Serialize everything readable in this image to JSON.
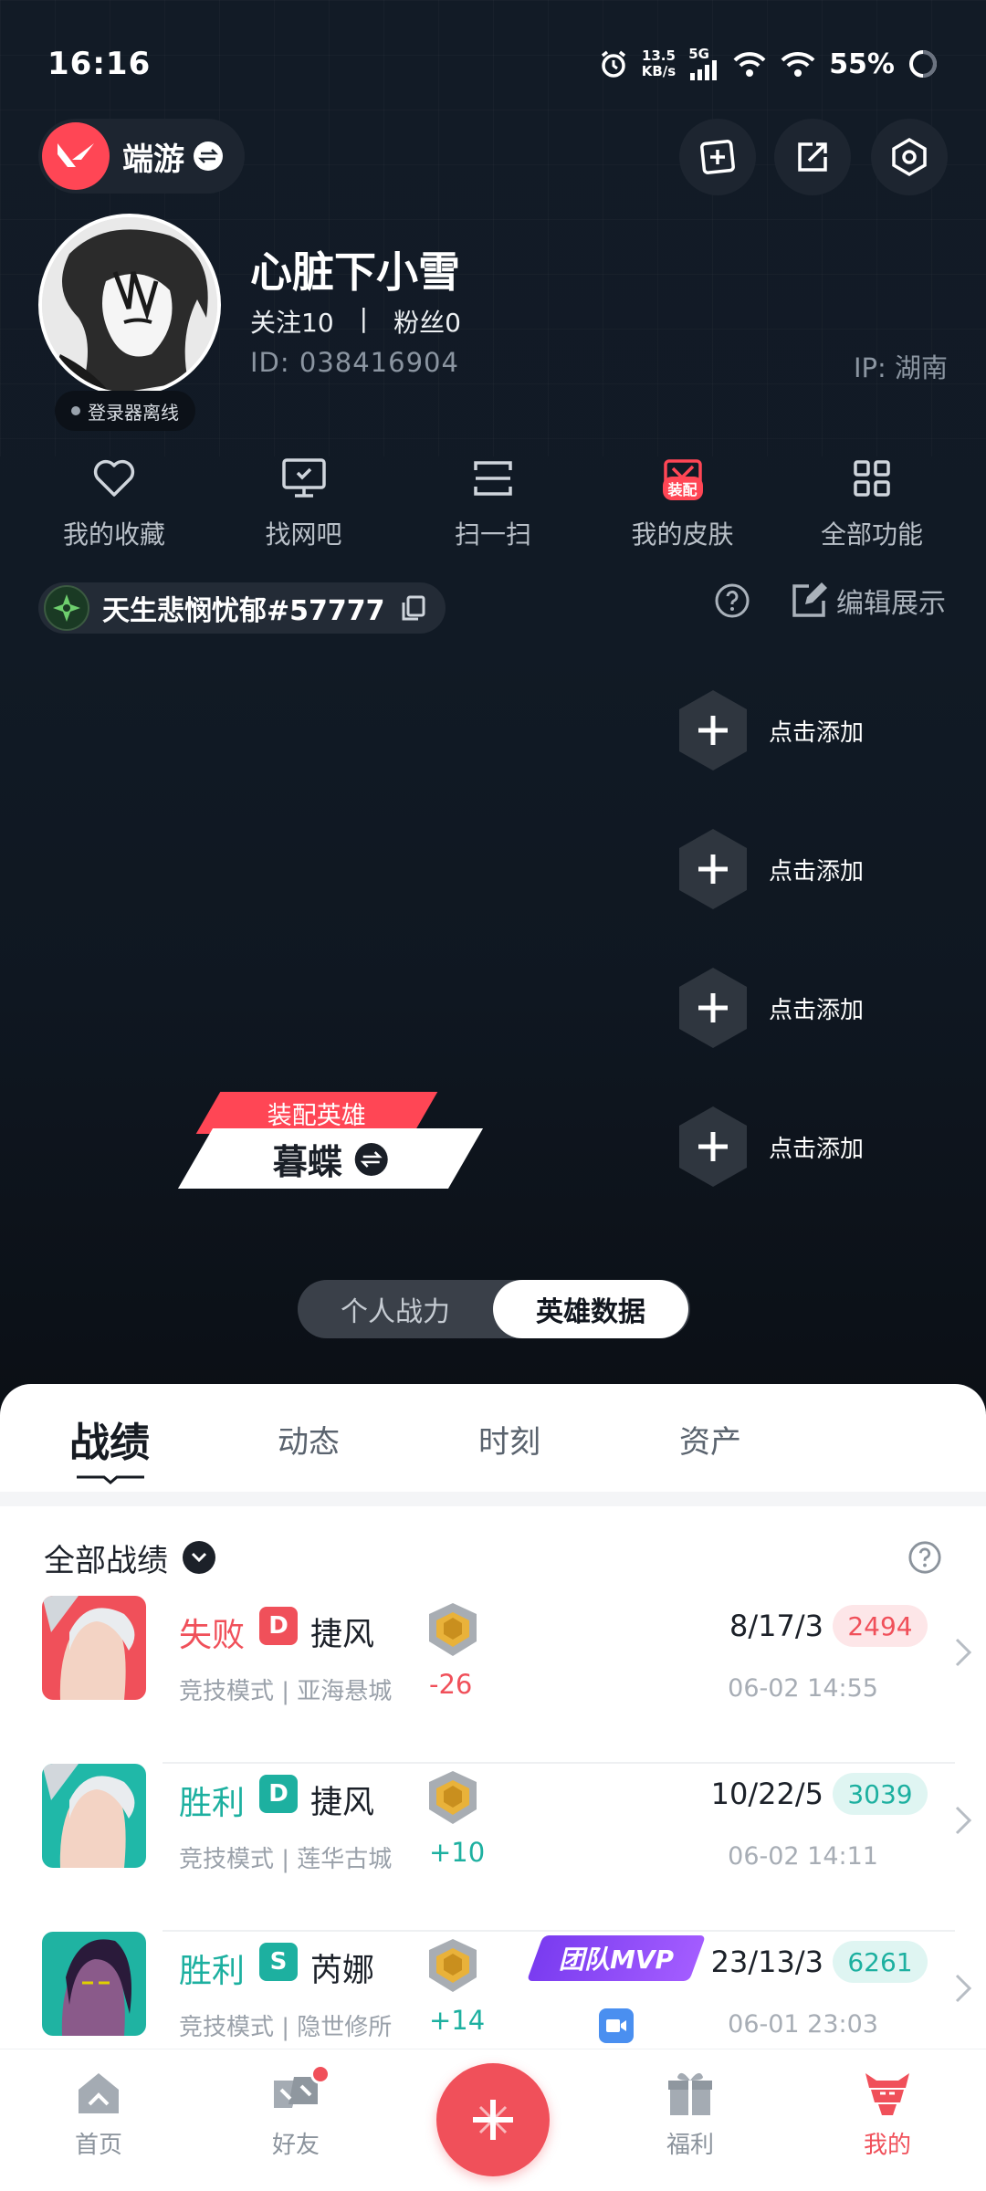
{
  "status": {
    "time": "16:16",
    "net_speed_value": "13.5",
    "net_speed_unit": "KB/s",
    "network": "5G",
    "battery": "55%"
  },
  "header": {
    "game_name": "端游"
  },
  "profile": {
    "name": "心脏下小雪",
    "following_label": "关注",
    "following_count": "10",
    "fans_label": "粉丝",
    "fans_count": "0",
    "separator": "|",
    "id_text": "ID:  038416904",
    "ip_text": "IP:  湖南",
    "login_status": "登录器离线"
  },
  "quick_functions": [
    {
      "label": "我的收藏",
      "icon": "heart-icon"
    },
    {
      "label": "找网吧",
      "icon": "monitor-icon"
    },
    {
      "label": "扫一扫",
      "icon": "scan-icon"
    },
    {
      "label": "我的皮肤",
      "icon": "skin-icon",
      "tag": "装配"
    },
    {
      "label": "全部功能",
      "icon": "grid-icon"
    }
  ],
  "riot_id": "天生悲悯忧郁#57777",
  "edit_show_label": "编辑展示",
  "add_slots": [
    {
      "label": "点击添加"
    },
    {
      "label": "点击添加"
    },
    {
      "label": "点击添加"
    },
    {
      "label": "点击添加"
    }
  ],
  "equipped_hero": {
    "tag": "装配英雄",
    "name": "暮蝶"
  },
  "segment": {
    "left": "个人战力",
    "right": "英雄数据",
    "active": "right"
  },
  "tabs": [
    "战绩",
    "动态",
    "时刻",
    "资产"
  ],
  "filter_label": "全部战绩",
  "matches": [
    {
      "result": "失败",
      "result_type": "lose",
      "mode_letter": "D",
      "agent": "捷风",
      "sub": "竞技模式 | 亚海悬城",
      "rr": "-26",
      "kda": "8/17/3",
      "score": "2494",
      "time": "06-02 14:55"
    },
    {
      "result": "胜利",
      "result_type": "win",
      "mode_letter": "D",
      "agent": "捷风",
      "sub": "竞技模式 | 莲华古城",
      "rr": "+10",
      "kda": "10/22/5",
      "score": "3039",
      "time": "06-02 14:11"
    },
    {
      "result": "胜利",
      "result_type": "win",
      "mode_letter": "S",
      "agent": "芮娜",
      "sub": "竞技模式 | 隐世修所",
      "rr": "+14",
      "kda": "23/13/3",
      "score": "6261",
      "time": "06-01 23:03",
      "badge": "团队MVP"
    }
  ],
  "nav": [
    {
      "label": "首页",
      "icon": "home-icon"
    },
    {
      "label": "好友",
      "icon": "friends-icon"
    },
    {
      "label": "福利",
      "icon": "gift-icon"
    },
    {
      "label": "我的",
      "icon": "me-icon",
      "active": true
    }
  ],
  "colors": {
    "accent": "#f0505a",
    "win": "#1db0a0",
    "brand": "#ff4655"
  }
}
